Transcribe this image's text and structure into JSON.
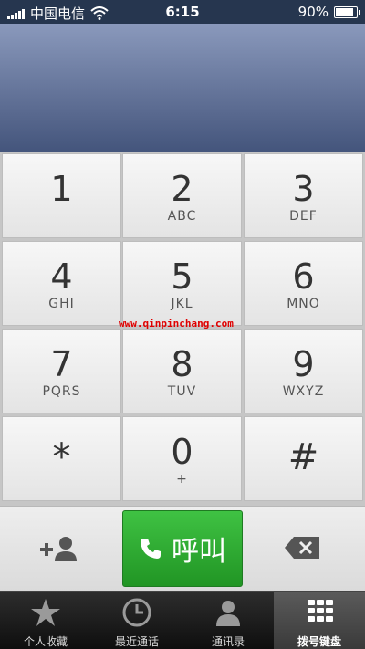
{
  "status_bar": {
    "carrier": "中国电信",
    "time": "6:15",
    "battery": "90%"
  },
  "keypad": {
    "keys": [
      {
        "digit": "1",
        "letters": ""
      },
      {
        "digit": "2",
        "letters": "ABC"
      },
      {
        "digit": "3",
        "letters": "DEF"
      },
      {
        "digit": "4",
        "letters": "GHI"
      },
      {
        "digit": "5",
        "letters": "JKL"
      },
      {
        "digit": "6",
        "letters": "MNO"
      },
      {
        "digit": "7",
        "letters": "PQRS"
      },
      {
        "digit": "8",
        "letters": "TUV"
      },
      {
        "digit": "9",
        "letters": "WXYZ"
      },
      {
        "digit": "*",
        "letters": ""
      },
      {
        "digit": "0",
        "letters": "+"
      },
      {
        "digit": "#",
        "letters": ""
      }
    ]
  },
  "watermark": "www.qinpinchang.com",
  "actions": {
    "call_label": "呼叫",
    "add_contact_icon": "add-contact-icon",
    "delete_icon": "backspace-icon",
    "call_icon": "phone-icon"
  },
  "tabs": [
    {
      "label": "个人收藏",
      "icon": "star-icon"
    },
    {
      "label": "最近通话",
      "icon": "clock-icon"
    },
    {
      "label": "通讯录",
      "icon": "contacts-icon"
    },
    {
      "label": "拨号键盘",
      "icon": "keypad-icon",
      "active": true
    }
  ],
  "colors": {
    "call_green": "#2aa12e",
    "display_blue": "#59698f"
  }
}
